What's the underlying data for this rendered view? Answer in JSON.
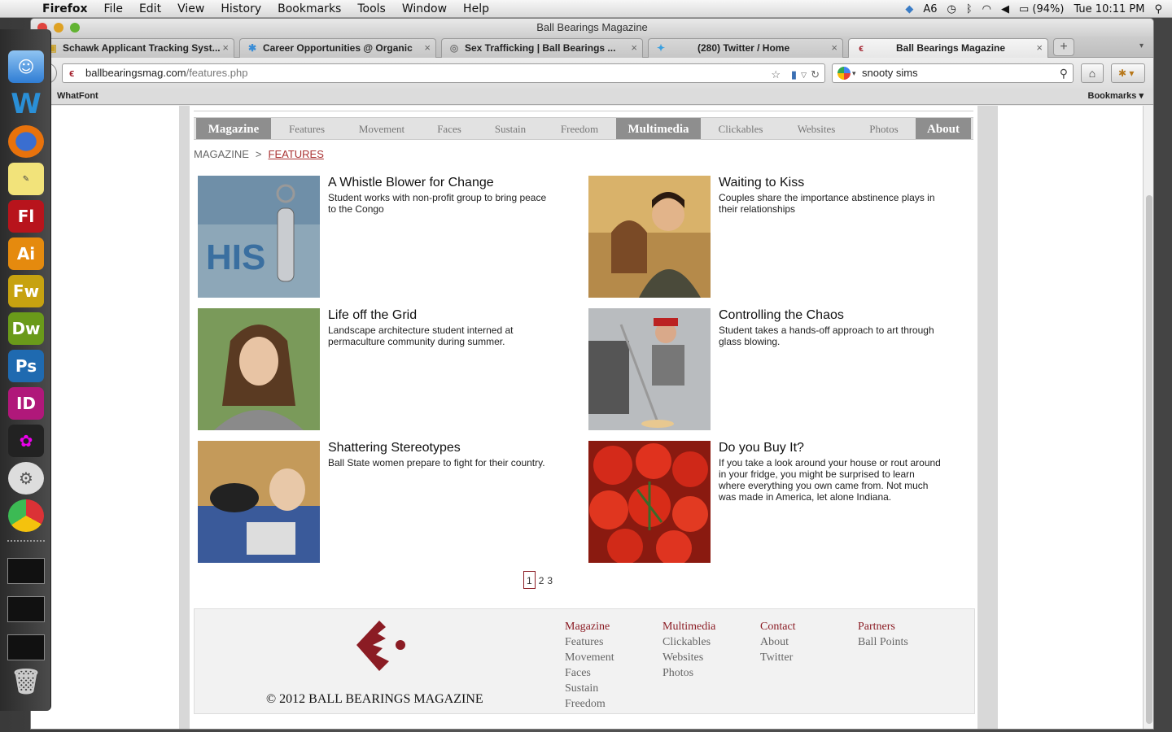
{
  "menubar": {
    "app": "Firefox",
    "items": [
      "File",
      "Edit",
      "View",
      "History",
      "Bookmarks",
      "Tools",
      "Window",
      "Help"
    ],
    "status": {
      "notify_count": "6",
      "battery": "(94%)",
      "clock": "Tue 10:11 PM"
    }
  },
  "window": {
    "title": "Ball Bearings Magazine",
    "tabs": [
      {
        "label": "Schawk Applicant Tracking Syst..."
      },
      {
        "label": "Career Opportunities @ Organic"
      },
      {
        "label": "Sex Trafficking | Ball Bearings ..."
      },
      {
        "label": "(280) Twitter / Home"
      },
      {
        "label": "Ball Bearings Magazine"
      }
    ],
    "url_domain": "ballbearingsmag.com",
    "url_path": "/features.php",
    "search_query": "snooty sims",
    "bookmarks_left": "WhatFont",
    "bookmarks_right": "Bookmarks"
  },
  "site": {
    "nav": [
      "Magazine",
      "Features",
      "Movement",
      "Faces",
      "Sustain",
      "Freedom",
      "Multimedia",
      "Clickables",
      "Websites",
      "Photos",
      "About"
    ],
    "breadcrumb": {
      "root": "MAGAZINE",
      "sep": ">",
      "current": "FEATURES"
    },
    "articles": [
      {
        "title": "A Whistle Blower for Change",
        "desc": "Student works with non-profit group to bring peace to the Congo"
      },
      {
        "title": "Waiting to Kiss",
        "desc": "Couples share the importance abstinence plays in their relationships"
      },
      {
        "title": "Life off the Grid",
        "desc": "Landscape architecture student interned at permaculture community during summer."
      },
      {
        "title": "Controlling the Chaos",
        "desc": "Student takes a hands-off approach to art through glass blowing."
      },
      {
        "title": "Shattering Stereotypes",
        "desc": "Ball State women prepare to fight for their country."
      },
      {
        "title": "Do you Buy It?",
        "desc": "If you take a look around your house or rout around in your fridge, you might be surprised to learn where everything you own came from. Not much was made in America, let alone Indiana."
      }
    ],
    "pages": [
      "1",
      "2",
      "3"
    ],
    "footer": {
      "copyright": "© 2012 BALL BEARINGS MAGAZINE",
      "columns": [
        {
          "head": "Magazine",
          "links": [
            "Features",
            "Movement",
            "Faces",
            "Sustain",
            "Freedom"
          ]
        },
        {
          "head": "Multimedia",
          "links": [
            "Clickables",
            "Websites",
            "Photos"
          ]
        },
        {
          "head": "Contact",
          "links": [
            "About",
            "Twitter"
          ]
        },
        {
          "head": "Partners",
          "links": [
            "Ball Points"
          ]
        }
      ]
    },
    "brand_color": "#8b1c24"
  }
}
